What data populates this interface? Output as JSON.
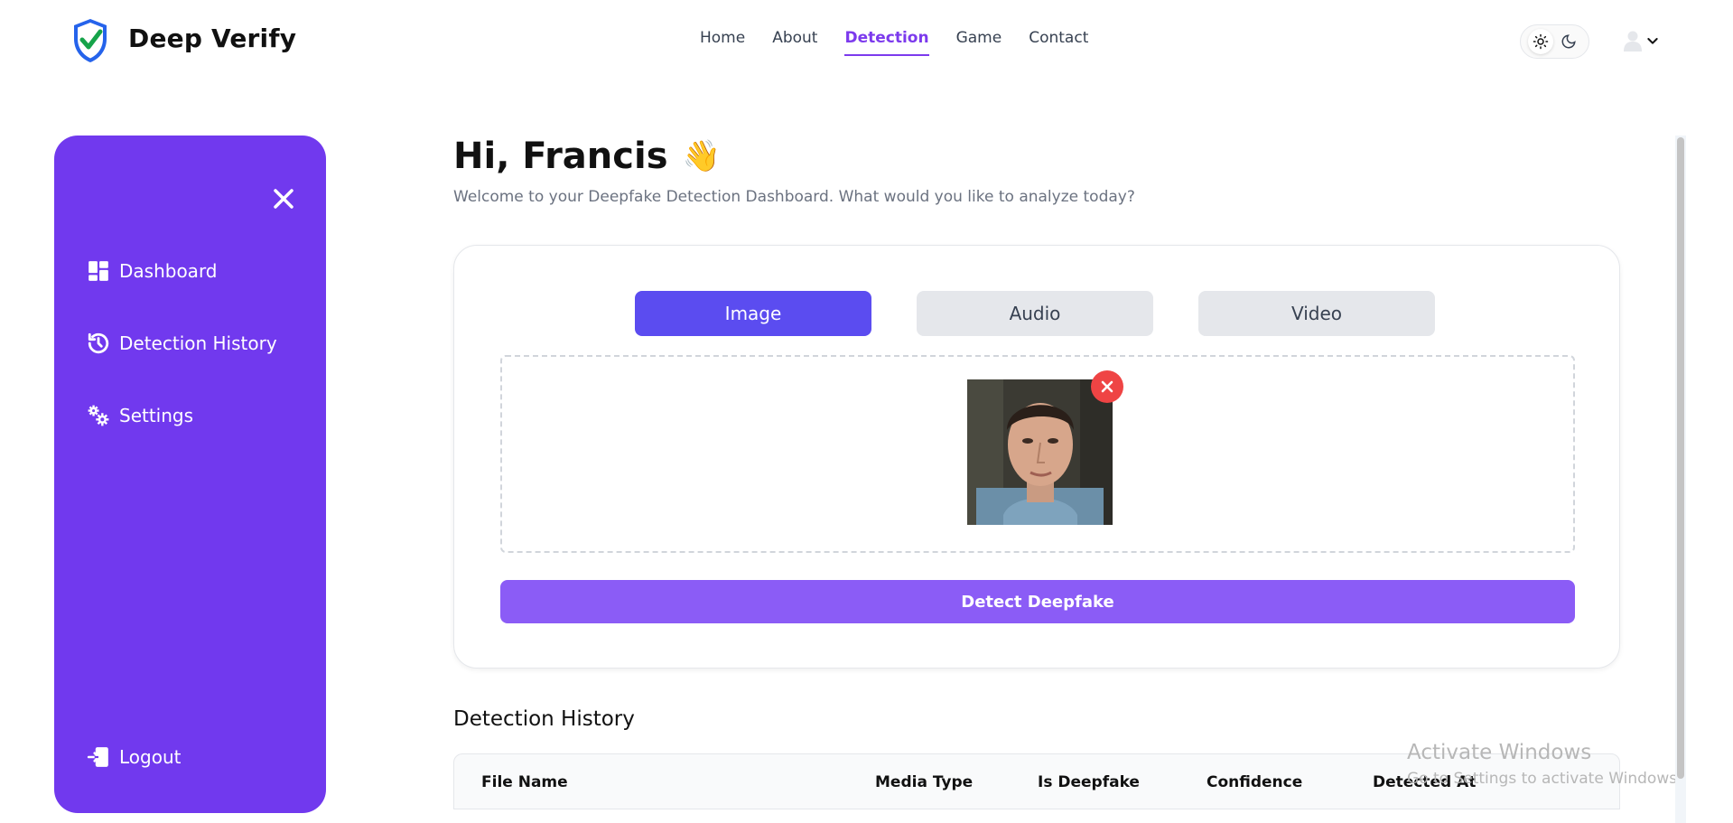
{
  "header": {
    "brand": "Deep Verify",
    "nav": [
      {
        "label": "Home"
      },
      {
        "label": "About"
      },
      {
        "label": "Detection",
        "active": true
      },
      {
        "label": "Game"
      },
      {
        "label": "Contact"
      }
    ],
    "theme_toggle": {
      "light_icon": "sun-icon",
      "dark_icon": "moon-icon"
    },
    "user_menu": {
      "icon": "user-icon",
      "chevron": "chevron-down-icon"
    }
  },
  "sidebar": {
    "close_icon": "close-icon",
    "items": [
      {
        "label": "Dashboard",
        "icon": "dashboard-icon"
      },
      {
        "label": "Detection History",
        "icon": "history-icon"
      },
      {
        "label": "Settings",
        "icon": "settings-icon"
      }
    ],
    "logout": {
      "label": "Logout",
      "icon": "logout-icon"
    }
  },
  "main": {
    "greeting": "Hi, Francis",
    "greeting_emoji": "👋",
    "subtitle": "Welcome to your Deepfake Detection Dashboard. What would you like to analyze today?",
    "tabs": [
      {
        "label": "Image",
        "active": true
      },
      {
        "label": "Audio"
      },
      {
        "label": "Video"
      }
    ],
    "upload": {
      "has_preview": true,
      "remove_icon": "close-icon"
    },
    "detect_button": "Detect Deepfake",
    "history_title": "Detection History",
    "table_columns": [
      "File Name",
      "Media Type",
      "Is Deepfake",
      "Confidence",
      "Detected At"
    ]
  },
  "watermark": {
    "line1": "Activate Windows",
    "line2": "Go to Settings to activate Windows."
  },
  "colors": {
    "sidebar": "#7139ee",
    "active_tab": "#5b4cf0",
    "detect_button": "#8b5cf6",
    "nav_active": "#7c3aed",
    "remove_button": "#ef4444"
  }
}
